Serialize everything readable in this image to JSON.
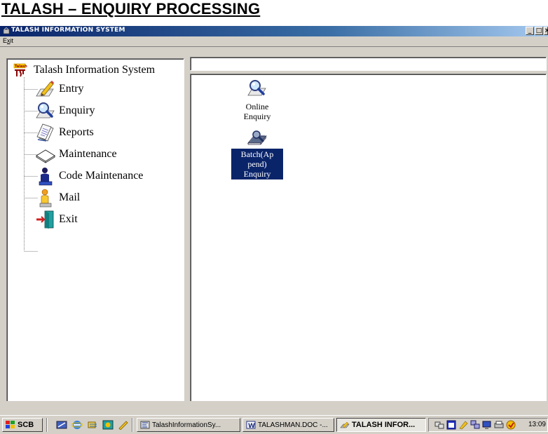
{
  "document": {
    "heading": "TALASH – ENQUIRY PROCESSING"
  },
  "window": {
    "title": "TALASH INFORMATION SYSTEM",
    "buttons": {
      "minimize": "_",
      "maximize": "□"
    }
  },
  "menu": {
    "exit_first": "E",
    "exit_u": "x",
    "exit_rest": "it"
  },
  "address_bar": {
    "value": ""
  },
  "tree": {
    "root": "Talash Information System",
    "root_icon_text": "Talash",
    "items": [
      {
        "label": "Entry",
        "icon": "pencil-paper-icon"
      },
      {
        "label": "Enquiry",
        "icon": "magnifier-paper-icon"
      },
      {
        "label": "Reports",
        "icon": "report-sheets-icon"
      },
      {
        "label": "Maintenance",
        "icon": "diamond-tray-icon"
      },
      {
        "label": "Code Maintenance",
        "icon": "person-blue-icon"
      },
      {
        "label": "Mail",
        "icon": "person-yellow-icon"
      },
      {
        "label": "Exit",
        "icon": "exit-door-icon"
      }
    ]
  },
  "content_icons": [
    {
      "label_line1": "Online",
      "label_line2": "Enquiry",
      "icon": "magnifier-paper-icon",
      "selected": false
    },
    {
      "label_line1": "Batch(Ap",
      "label_line2": "pend)",
      "label_line3": "Enquiry",
      "icon": "batch-stack-icon",
      "selected": true
    }
  ],
  "taskbar": {
    "start_label": "SCB",
    "tasks": [
      {
        "label": "TalashInformationSy..."
      },
      {
        "label": "TALASHMAN.DOC -..."
      },
      {
        "label": "TALASH INFOR..."
      }
    ],
    "clock": "13:09"
  },
  "colors": {
    "titlebar": "#0a246a",
    "selection": "#0a246a",
    "face": "#d4d0c8"
  }
}
